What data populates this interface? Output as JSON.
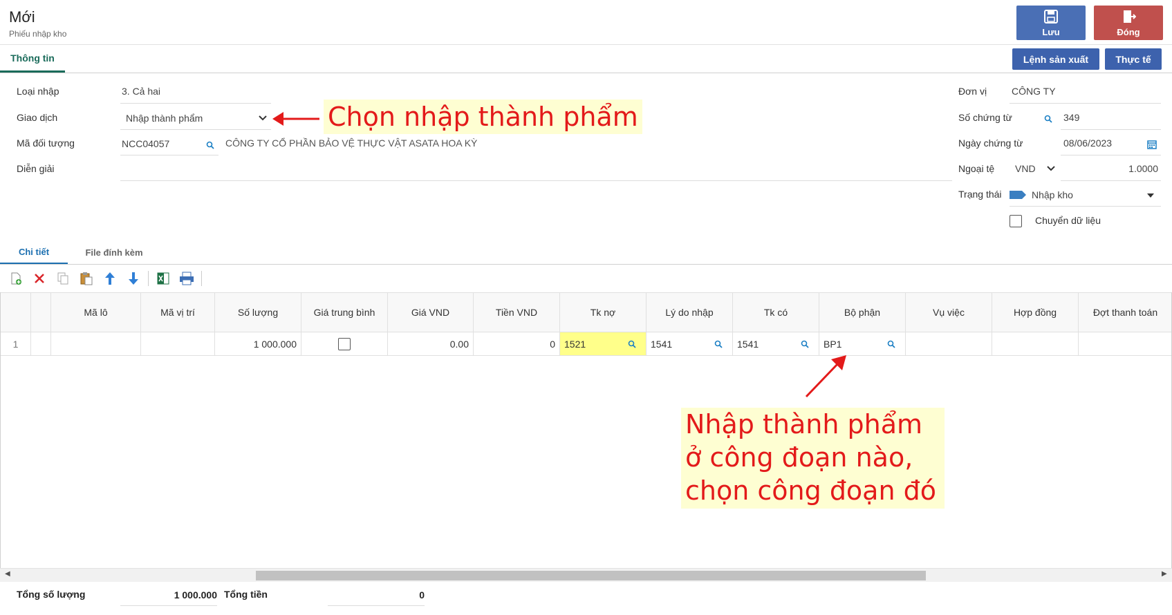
{
  "header": {
    "title": "Mới",
    "subtitle": "Phiếu nhập kho"
  },
  "actions": {
    "save_label": "Lưu",
    "close_label": "Đóng",
    "lenh_label": "Lệnh sản xuất",
    "thucte_label": "Thực tế"
  },
  "tabs": {
    "info": "Thông tin"
  },
  "form": {
    "loai_nhap_label": "Loại nhập",
    "loai_nhap_value": "3. Cả hai",
    "giao_dich_label": "Giao dịch",
    "giao_dich_value": "Nhập thành phẩm",
    "ma_doi_tuong_label": "Mã đối tượng",
    "ma_doi_tuong_value": "NCC04057",
    "ten_doi_tuong": "CÔNG TY CỔ PHẦN BẢO VỆ THỰC VẬT ASATA HOA KỲ",
    "dien_giai_label": "Diễn giải",
    "don_vi_label": "Đơn vị",
    "don_vi_value": "CÔNG TY",
    "so_chung_tu_label": "Số chứng từ",
    "so_chung_tu_value": "349",
    "ngay_chung_tu_label": "Ngày chứng từ",
    "ngay_chung_tu_value": "08/06/2023",
    "ngoai_te_label": "Ngoại tệ",
    "ngoai_te_value": "VND",
    "ty_gia_value": "1.0000",
    "trang_thai_label": "Trạng thái",
    "trang_thai_value": "Nhập kho",
    "chuyen_du_lieu_label": "Chuyển dữ liệu"
  },
  "annotations": {
    "note1": "Chọn nhập thành phẩm",
    "note2": "Nhập thành phẩm ở công đoạn nào, chọn công đoạn đó",
    "color": "#e31a1a"
  },
  "detail_tabs": {
    "chi_tiet": "Chi tiết",
    "file": "File đính kèm"
  },
  "toolbar": [
    "add-row-icon",
    "delete-icon",
    "copy-icon",
    "paste-icon",
    "move-up-icon",
    "move-down-icon",
    "excel-icon",
    "print-icon"
  ],
  "grid": {
    "columns": [
      "",
      "",
      "Mã lô",
      "Mã vị trí",
      "Số lượng",
      "Giá trung bình",
      "Giá VND",
      "Tiền VND",
      "Tk nợ",
      "Lý do nhập",
      "Tk có",
      "Bộ phận",
      "Vụ việc",
      "Hợp đồng",
      "Đợt thanh toán"
    ],
    "row": {
      "stt": "1",
      "ma_lo": "",
      "ma_vi_tri": "",
      "so_luong": "1 000.000",
      "gia_tb_checked": false,
      "gia_vnd": "0.00",
      "tien_vnd": "0",
      "tk_no": "1521",
      "ly_do_nhap": "1541",
      "tk_co": "1541",
      "bo_phan": "BP1",
      "vu_viec": "",
      "hop_dong": "",
      "dot_thanh_toan": ""
    }
  },
  "footer": {
    "qty_label": "Tổng số lượng",
    "qty_value": "1 000.000",
    "money_label": "Tổng tiền",
    "money_value": "0"
  },
  "colors": {
    "primary": "#3d62ad",
    "danger": "#c0504d",
    "tab_green": "#1a6b5a",
    "tab_blue": "#1b6fb0",
    "highlight": "#ffff8a"
  }
}
